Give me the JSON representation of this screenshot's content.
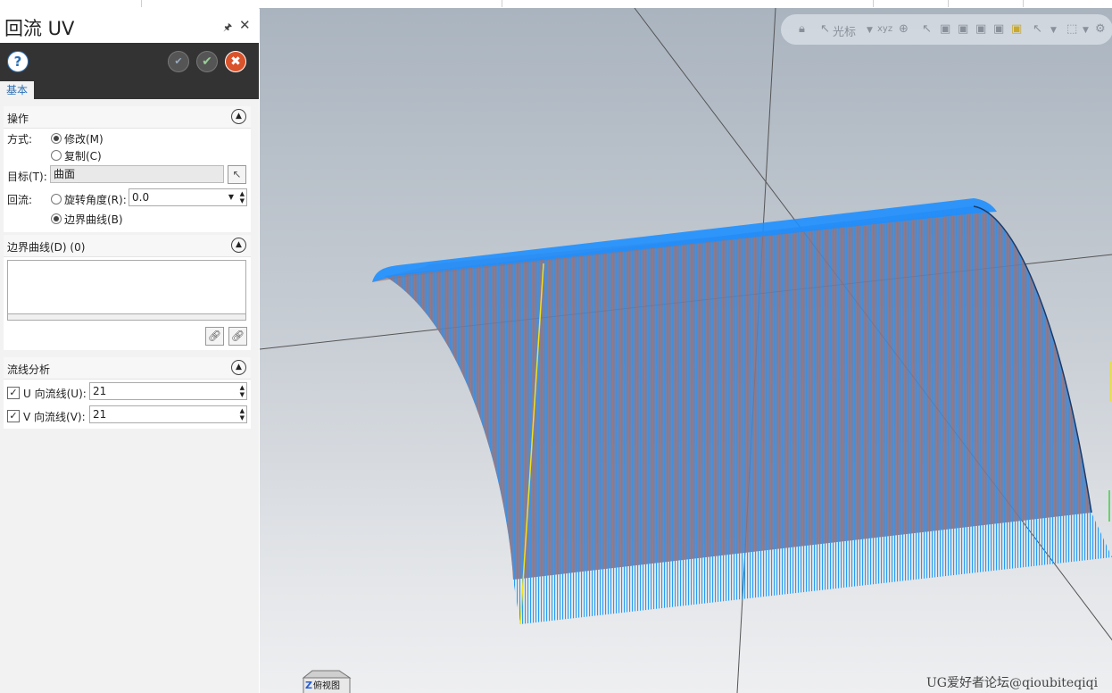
{
  "dialog": {
    "title": "回流 UV",
    "pin_icon": "pin-icon",
    "close_icon": "close-icon",
    "buttons": {
      "help": "?",
      "apply": "apply-icon",
      "ok": "ok-icon",
      "cancel": "cancel-icon"
    },
    "tab": "基本"
  },
  "operation": {
    "header": "操作",
    "mode_label": "方式:",
    "mode_options": [
      "修改(M)",
      "复制(C)"
    ],
    "mode_selected": "修改(M)",
    "target_label": "目标(T):",
    "target_value": "曲面",
    "flow_label": "回流:",
    "rotate_option": "旋转角度(R):",
    "rotate_value": "0.0",
    "boundary_option": "边界曲线(B)",
    "flow_selected": "边界曲线(B)"
  },
  "boundary_curves": {
    "header": "边界曲线(D) (0)"
  },
  "streamline": {
    "header": "流线分析",
    "u_label": "U 向流线(U):",
    "u_checked": true,
    "u_value": "21",
    "v_label": "V 向流线(V):",
    "v_checked": true,
    "v_value": "21"
  },
  "viewport": {
    "toolbar_cursor_label": "光标",
    "cube_label": "俯视图",
    "cube_axis": "Z",
    "watermark": "UG爱好者论坛@qioubiteqiqi",
    "colors": {
      "surface_fill": "#5f7fa8",
      "streamline_blue": "#1e8fff",
      "streamline_red": "#c06050",
      "axis_yellow": "#f0e020"
    }
  }
}
